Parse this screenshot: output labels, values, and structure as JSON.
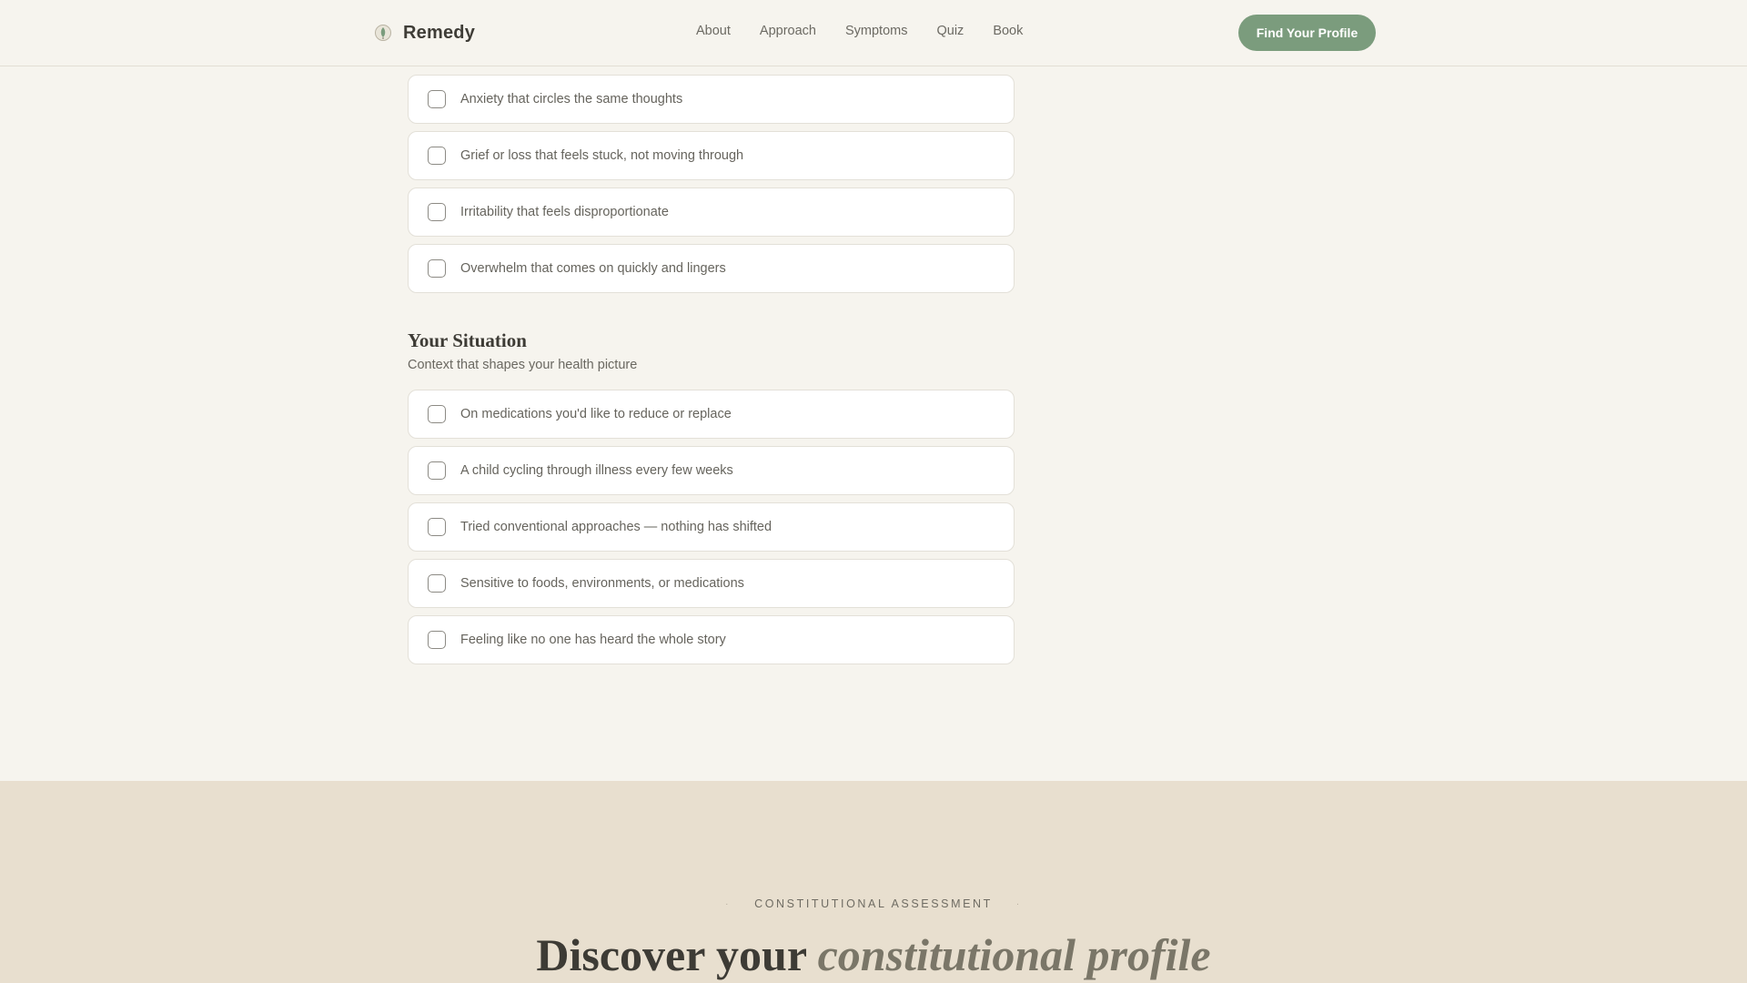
{
  "header": {
    "brand": "Remedy",
    "nav": [
      "About",
      "Approach",
      "Symptoms",
      "Quiz",
      "Book"
    ],
    "cta": "Find Your Profile"
  },
  "emotional_items": [
    "Anxiety that circles the same thoughts",
    "Grief or loss that feels stuck, not moving through",
    "Irritability that feels disproportionate",
    "Overwhelm that comes on quickly and lingers"
  ],
  "situation": {
    "title": "Your Situation",
    "subtitle": "Context that shapes your health picture",
    "items": [
      "On medications you'd like to reduce or replace",
      "A child cycling through illness every few weeks",
      "Tried conventional approaches — nothing has shifted",
      "Sensitive to foods, environments, or medications",
      "Feeling like no one has heard the whole story"
    ]
  },
  "assessment": {
    "eyebrow": "CONSTITUTIONAL ASSESSMENT",
    "headline_plain": "Discover your",
    "headline_italic": "constitutional profile"
  },
  "colors": {
    "background": "#f6f4ee",
    "accent": "#7b9c7d",
    "band": "#e8dfcf"
  }
}
